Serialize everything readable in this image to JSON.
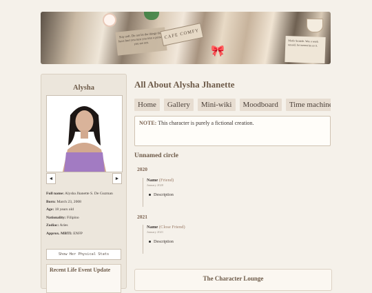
{
  "banner": {
    "sticker_text": "Stay soft. Do not let the things that have hurt you turn you into a person you are not.",
    "sign_text": "CAFE COMFY",
    "card_text": "Marla Seaside. Was a week unsaid, for memories so it."
  },
  "sidebar": {
    "name": "Alysha",
    "prev_label": "◄",
    "next_label": "►",
    "stats": [
      {
        "label": "Full name:",
        "value": "Alysha Jhanette S. De Guzman"
      },
      {
        "label": "Born:",
        "value": "March 23, 2008"
      },
      {
        "label": "Age:",
        "value": "18 years old"
      },
      {
        "label": "Nationality:",
        "value": "Filipino"
      },
      {
        "label": "Zodiac:",
        "value": "Aries"
      },
      {
        "label": "Approx. MBTI:",
        "value": "ENFP"
      }
    ],
    "show_stats_label": "Show Her Physical Stats",
    "recent_title": "Recent Life Event Update"
  },
  "main": {
    "title": "All About Alysha Jhanette",
    "tabs": [
      "Home",
      "Gallery",
      "Mini-wiki",
      "Moodboard",
      "Time machine"
    ],
    "note_label": "NOTE:",
    "note_text": "This character is purely a fictional creation.",
    "circle_title": "Unnamed circle",
    "groups": [
      {
        "year": "2020",
        "name": "Name",
        "relation": "(Friend)",
        "date": "January 2020",
        "desc": "Description"
      },
      {
        "year": "2021",
        "name": "Name",
        "relation": "(Close Friend)",
        "date": "January 2021",
        "desc": "Description"
      }
    ],
    "lounge_title": "The Character Lounge"
  },
  "colors": {
    "background": "#f5f1ea",
    "accent": "#6d5a48",
    "tab_bg": "#e7ddd1"
  }
}
